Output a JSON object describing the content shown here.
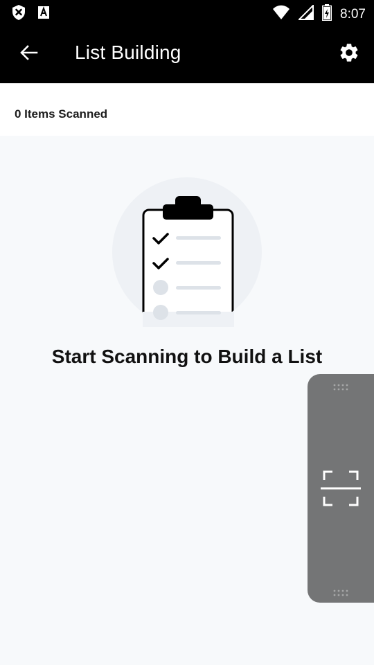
{
  "status_bar": {
    "time": "8:07",
    "icons": [
      "shield-x-icon",
      "font-a-icon",
      "wifi-icon",
      "signal-icon",
      "battery-icon"
    ]
  },
  "app_bar": {
    "title": "List Building",
    "back_icon": "arrow-left-icon",
    "settings_icon": "gear-icon"
  },
  "summary": {
    "items_scanned": "0 Items Scanned"
  },
  "empty_state": {
    "illustration": "clipboard-checklist-icon",
    "title": "Start Scanning to Build a List"
  },
  "scan_panel": {
    "icon": "scan-frame-icon"
  },
  "colors": {
    "app_bar": "#000000",
    "background": "#f7f9fb",
    "scan_panel": "#747576"
  }
}
